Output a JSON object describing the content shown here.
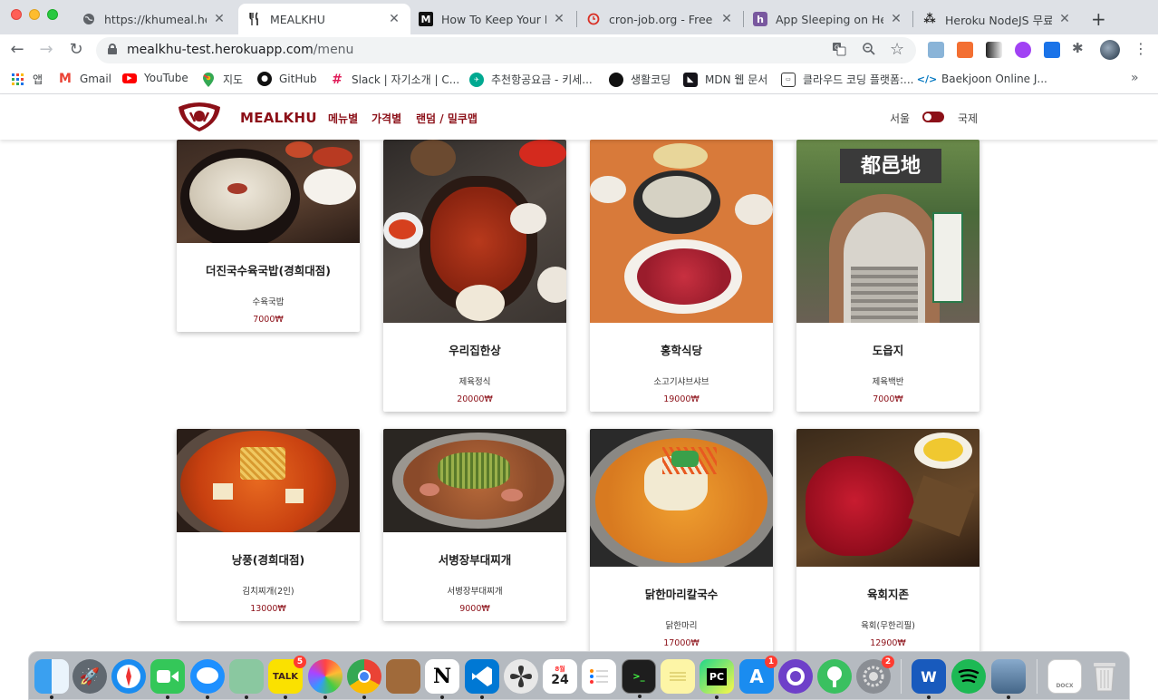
{
  "browser": {
    "tabs": [
      {
        "title": "https://khumeal.herok",
        "favicon": "globe-icon",
        "active": false
      },
      {
        "title": "MEALKHU",
        "favicon": "fork-knife-icon",
        "active": true
      },
      {
        "title": "How To Keep Your Fre",
        "favicon": "medium-icon",
        "active": false
      },
      {
        "title": "cron-job.org - Free cr",
        "favicon": "cron-icon",
        "active": false
      },
      {
        "title": "App Sleeping on Hero",
        "favicon": "heroku-icon",
        "active": false
      },
      {
        "title": "Heroku NodeJS 무료 -",
        "favicon": "velog-icon",
        "active": false
      }
    ],
    "url_host": "mealkhu-test.herokuapp.com",
    "url_path": "/menu",
    "bookmarks": [
      {
        "label": "앱",
        "icon": "apps-grid-icon"
      },
      {
        "label": "Gmail",
        "icon": "gmail-icon"
      },
      {
        "label": "YouTube",
        "icon": "youtube-icon"
      },
      {
        "label": "지도",
        "icon": "maps-pin-icon"
      },
      {
        "label": "GitHub",
        "icon": "github-icon"
      },
      {
        "label": "Slack | 자기소개 | C...",
        "icon": "slack-icon"
      },
      {
        "label": "추천항공요금 - 키세...",
        "icon": "kiwi-icon"
      },
      {
        "label": "생활코딩",
        "icon": "circle-icon"
      },
      {
        "label": "MDN 웹 문서",
        "icon": "mdn-icon"
      },
      {
        "label": "클라우드 코딩 플랫폼:...",
        "icon": "goorm-icon"
      },
      {
        "label": "Baekjoon Online J...",
        "icon": "code-icon"
      }
    ]
  },
  "site": {
    "brand": "MEALKHU",
    "nav": [
      "메뉴별",
      "가격별",
      "랜덤 / 밀쿠맵"
    ],
    "region_left": "서울",
    "region_right": "국제",
    "accent": "#8c1018"
  },
  "cards": [
    {
      "name": "더진국수육국밥(경희대점)",
      "menu": "수육국밥",
      "price": "7000₩"
    },
    {
      "name": "우리집한상",
      "menu": "제육정식",
      "price": "20000₩"
    },
    {
      "name": "홍학식당",
      "menu": "소고기샤브샤브",
      "price": "19000₩"
    },
    {
      "name": "도읍지",
      "menu": "제육백반",
      "price": "7000₩"
    },
    {
      "name": "낭풍(경희대점)",
      "menu": "김치찌개(2인)",
      "price": "13000₩"
    },
    {
      "name": "서병장부대찌개",
      "menu": "서병장부대찌개",
      "price": "9000₩"
    },
    {
      "name": "닭한마리칼국수",
      "menu": "닭한마리",
      "price": "17000₩"
    },
    {
      "name": "육회지존",
      "menu": "육회(무한리필)",
      "price": "12900₩"
    }
  ],
  "photo_text": {
    "doeupji_sign": "都邑地"
  },
  "dock": {
    "badges": {
      "kakaotalk": "5",
      "calendar_day": "24",
      "calendar_month": "8월",
      "appstore": "1",
      "settings": "2"
    },
    "kakao_label": "TALK",
    "pycharm_label": "PC",
    "word_label": "W"
  }
}
